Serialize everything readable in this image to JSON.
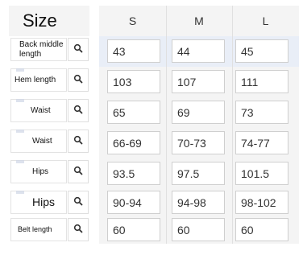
{
  "size_label": "Size",
  "columns": [
    "S",
    "M",
    "L"
  ],
  "rows": [
    {
      "label": "Back middle length",
      "values": [
        "43",
        "44",
        "45"
      ]
    },
    {
      "label": "Hem length",
      "values": [
        "103",
        "107",
        "111"
      ]
    },
    {
      "label": "Waist",
      "values": [
        "65",
        "69",
        "73"
      ]
    },
    {
      "label": "Waist",
      "values": [
        "66-69",
        "70-73",
        "74-77"
      ]
    },
    {
      "label": "Hips",
      "values": [
        "93.5",
        "97.5",
        "101.5"
      ]
    },
    {
      "label": "Hips",
      "values": [
        "90-94",
        "94-98",
        "98-102"
      ]
    },
    {
      "label": "Belt length",
      "values": [
        "60",
        "60",
        "60"
      ]
    }
  ],
  "icons": {
    "search": "search-icon"
  },
  "colors": {
    "highlight_row": "#e9eef7",
    "panel": "#f4f4f4",
    "border": "#cfcfcf"
  }
}
